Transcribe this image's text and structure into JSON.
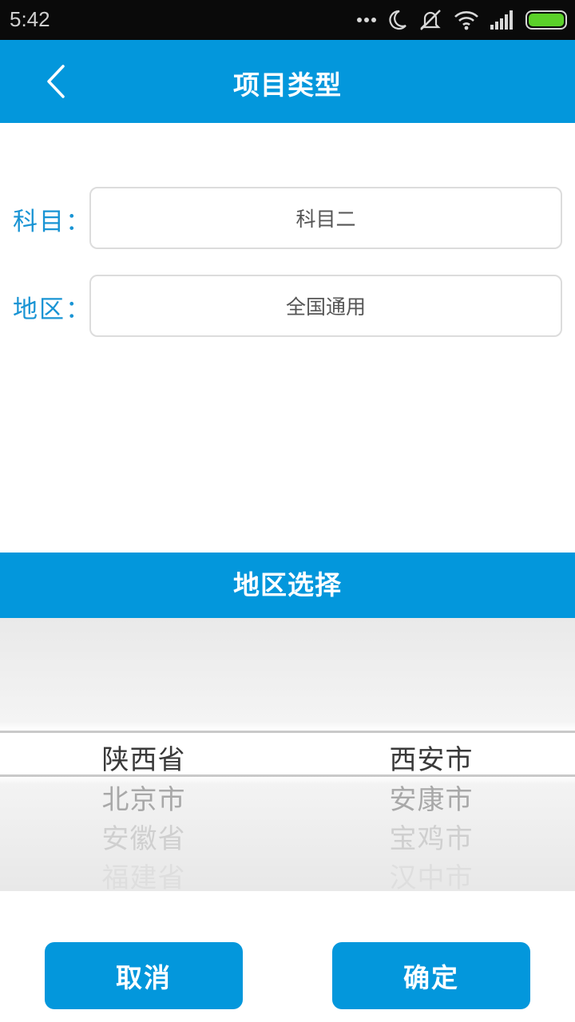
{
  "status_bar": {
    "time": "5:42",
    "icons": [
      "more-dots-icon",
      "moon-icon",
      "silent-mode-icon",
      "wifi-icon",
      "signal-icon",
      "battery-icon"
    ],
    "battery_color": "#5bd12a"
  },
  "header": {
    "title": "项目类型",
    "back_icon": "chevron-left-icon",
    "background": "#0397dc"
  },
  "form": {
    "subject_label": "科目：",
    "subject_value": "科目二",
    "region_label": "地区：",
    "region_value": "全国通用",
    "label_color": "#1994d4"
  },
  "picker": {
    "title": "地区选择",
    "provinces": [
      "陕西省",
      "北京市",
      "安徽省",
      "福建省"
    ],
    "cities": [
      "西安市",
      "安康市",
      "宝鸡市",
      "汉中市"
    ],
    "selected_province": "陕西省",
    "selected_city": "西安市"
  },
  "buttons": {
    "cancel": "取消",
    "confirm": "确定"
  }
}
